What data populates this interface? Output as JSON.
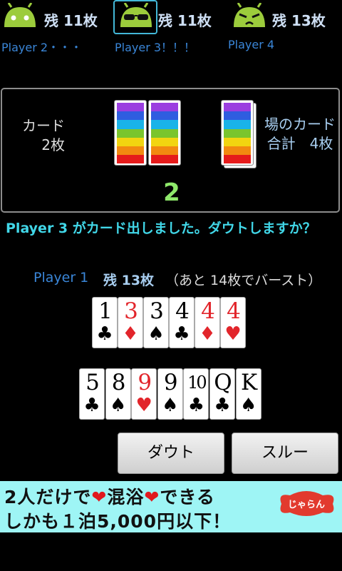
{
  "opponents": [
    {
      "name": "Player 2・・・",
      "remain": "残 11枚",
      "icon": "android-icon"
    },
    {
      "name": "Player 3！！！",
      "remain": "残 11枚",
      "icon": "android-sunglasses-icon"
    },
    {
      "name": "Player 4",
      "remain": "残 13枚",
      "icon": "android-angry-icon"
    }
  ],
  "field": {
    "played_label_1": "カード",
    "played_label_2": "2枚",
    "pile_label_1": "場のカード",
    "pile_label_2": "合計　4枚",
    "declared_number": "2"
  },
  "message": "Player 3 がカード出しました。ダウトしますか？",
  "me": {
    "name": "Player 1",
    "remain": "残 13枚",
    "burst_note": "（あと 14枚でバースト）"
  },
  "hand_row1": [
    {
      "rank": "1",
      "suit": "♣",
      "color": "black"
    },
    {
      "rank": "3",
      "suit": "♦",
      "color": "red"
    },
    {
      "rank": "3",
      "suit": "♠",
      "color": "black"
    },
    {
      "rank": "4",
      "suit": "♣",
      "color": "black"
    },
    {
      "rank": "4",
      "suit": "♦",
      "color": "red"
    },
    {
      "rank": "4",
      "suit": "♥",
      "color": "red"
    }
  ],
  "hand_row2": [
    {
      "rank": "5",
      "suit": "♣",
      "color": "black"
    },
    {
      "rank": "8",
      "suit": "♠",
      "color": "black"
    },
    {
      "rank": "9",
      "suit": "♥",
      "color": "red"
    },
    {
      "rank": "9",
      "suit": "♠",
      "color": "black"
    },
    {
      "rank": "10",
      "suit": "♣",
      "color": "black"
    },
    {
      "rank": "Q",
      "suit": "♣",
      "color": "black"
    },
    {
      "rank": "K",
      "suit": "♠",
      "color": "black"
    }
  ],
  "buttons": {
    "doubt": "ダウト",
    "through": "スルー"
  },
  "ad": {
    "line1_a": "2人だけで",
    "heart": "❤",
    "line1_b": "混浴",
    "line1_c": "できる",
    "line2": "しかも１泊5,000円以下！",
    "logo": "じゃらん"
  },
  "colors": {
    "accent": "#41d7e8",
    "player_name": "#3a86d8",
    "count": "#8ee86a",
    "ad_bg": "#9ef5f5"
  }
}
